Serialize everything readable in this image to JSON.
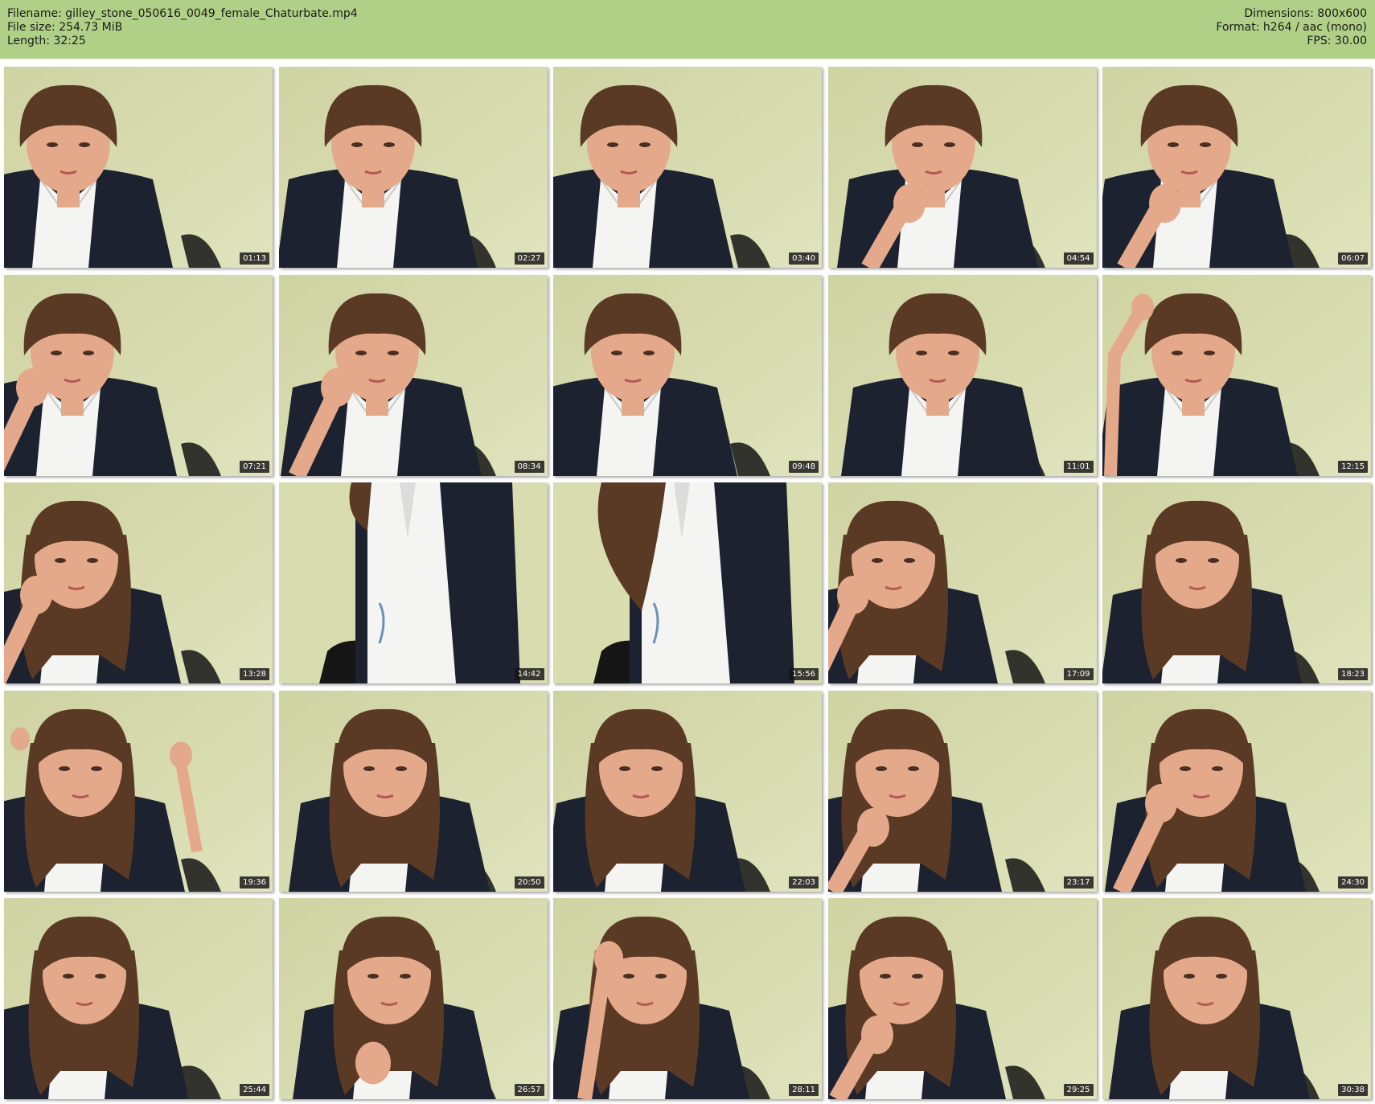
{
  "header": {
    "filename": "Filename: gilley_stone_050616_0049_female_Chaturbate.mp4",
    "filesize": "File size: 254.73 MiB",
    "length": "Length: 32:25",
    "dimensions": "Dimensions: 800x600",
    "format": "Format: h264 / aac (mono)",
    "fps": "FPS: 30.00"
  },
  "colors": {
    "header_bg": "#b1d087",
    "wall": "#d8dcae",
    "cardigan": "#1c2230",
    "shirt": "#f4f4f2",
    "hair": "#5a3a24",
    "skin": "#e4a98a"
  },
  "thumbnails": [
    {
      "time": "01:13",
      "pose": "face"
    },
    {
      "time": "02:27",
      "pose": "face"
    },
    {
      "time": "03:40",
      "pose": "face"
    },
    {
      "time": "04:54",
      "pose": "hand-chin"
    },
    {
      "time": "06:07",
      "pose": "hand-chin"
    },
    {
      "time": "07:21",
      "pose": "hand-cheek"
    },
    {
      "time": "08:34",
      "pose": "hand-cheek"
    },
    {
      "time": "09:48",
      "pose": "face"
    },
    {
      "time": "11:01",
      "pose": "face"
    },
    {
      "time": "12:15",
      "pose": "arm-up"
    },
    {
      "time": "13:28",
      "pose": "hand-cheek"
    },
    {
      "time": "14:42",
      "pose": "torso"
    },
    {
      "time": "15:56",
      "pose": "torso-hair"
    },
    {
      "time": "17:09",
      "pose": "hand-cheek"
    },
    {
      "time": "18:23",
      "pose": "face"
    },
    {
      "time": "19:36",
      "pose": "arms-up"
    },
    {
      "time": "20:50",
      "pose": "face"
    },
    {
      "time": "22:03",
      "pose": "face"
    },
    {
      "time": "23:17",
      "pose": "hand-chin"
    },
    {
      "time": "24:30",
      "pose": "hand-cheek"
    },
    {
      "time": "25:44",
      "pose": "face"
    },
    {
      "time": "26:57",
      "pose": "hand-chest"
    },
    {
      "time": "28:11",
      "pose": "hand-head"
    },
    {
      "time": "29:25",
      "pose": "hand-chin"
    },
    {
      "time": "30:38",
      "pose": "face"
    }
  ]
}
